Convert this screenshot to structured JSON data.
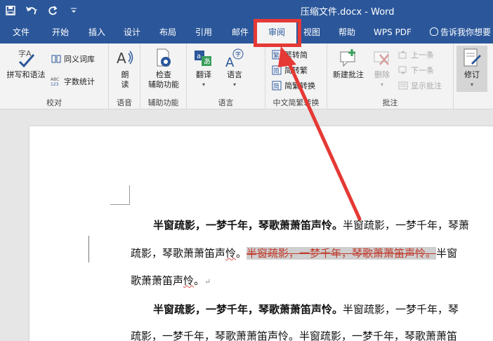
{
  "title_bar": {
    "document_name": "压缩文件.docx - Word",
    "quick_access": [
      {
        "name": "save-icon",
        "glyph": "💾"
      },
      {
        "name": "undo-icon",
        "glyph": "↶"
      },
      {
        "name": "redo-icon",
        "glyph": "↻"
      },
      {
        "name": "customize-icon",
        "glyph": "⩡"
      }
    ]
  },
  "tabs": [
    {
      "label": "文件",
      "active": false
    },
    {
      "label": "开始",
      "active": false
    },
    {
      "label": "插入",
      "active": false
    },
    {
      "label": "设计",
      "active": false
    },
    {
      "label": "布局",
      "active": false
    },
    {
      "label": "引用",
      "active": false
    },
    {
      "label": "邮件",
      "active": false
    },
    {
      "label": "审阅",
      "active": true
    },
    {
      "label": "视图",
      "active": false
    },
    {
      "label": "帮助",
      "active": false
    },
    {
      "label": "WPS PDF",
      "active": false
    }
  ],
  "tell_me": "告诉我你想要",
  "ribbon": {
    "proofing": {
      "group_label": "校对",
      "spelling": "拼写和语法",
      "thesaurus": "同义词库",
      "word_count": "字数统计"
    },
    "speech": {
      "group_label": "语音",
      "read_aloud_1": "朗",
      "read_aloud_2": "读"
    },
    "accessibility": {
      "group_label": "辅助功能",
      "check_1": "检查",
      "check_2": "辅助功能"
    },
    "language": {
      "group_label": "语言",
      "translate": "翻译",
      "language": "语言"
    },
    "chinese_conversion": {
      "group_label": "中文简繁转换",
      "to_simplified": "繁转简",
      "to_traditional": "简转繁",
      "conversion": "简繁转换"
    },
    "comments": {
      "group_label": "批注",
      "new_comment": "新建批注",
      "delete": "删除",
      "previous": "上一条",
      "next": "下一条",
      "show_comments": "显示批注"
    },
    "tracking": {
      "track_changes": "修订"
    }
  },
  "document": {
    "line1_bold": "半窗疏影，一梦千年，琴歌萧萧笛声怜。",
    "line1_normal": "半窗疏影，一梦千年，琴萧",
    "line2_a": "疏影，琴歌萧萧笛声",
    "line2_b": "怜",
    "line2_c": "。",
    "line2_deleted": "半窗疏影，一梦千年，琴歌萧萧笛声怜。",
    "line2_after": "半窗",
    "line3_a": "歌萧萧笛声",
    "line3_b": "怜",
    "line3_c": "。",
    "line4_bold": "半窗疏影，一梦千年，琴歌萧萧笛声怜。",
    "line4_normal": "半窗疏影，一梦千年，琴",
    "line5": "疏影，一梦千年，琴歌萧萧笛声怜。半窗疏影，一梦千年，琴歌萧萧笛"
  },
  "colors": {
    "ribbon_blue": "#2b579a",
    "highlight_red": "#e53935",
    "deleted_text": "#c0392b"
  }
}
